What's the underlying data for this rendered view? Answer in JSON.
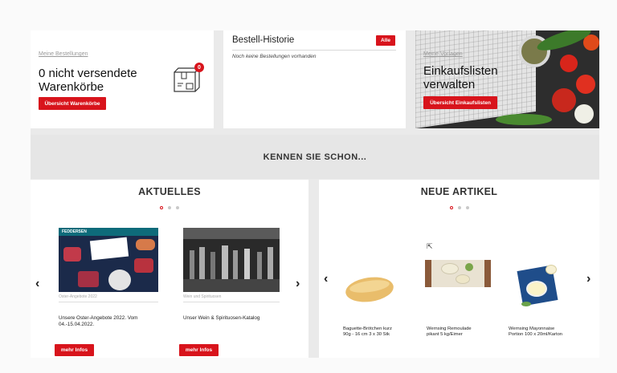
{
  "cards": {
    "orders": {
      "link": "Meine Bestellungen",
      "title_line1": "0 nicht versendete",
      "title_line2": "Warenkörbe",
      "button": "Übersicht Warenkörbe",
      "badge": "0"
    },
    "history": {
      "title": "Bestell-Historie",
      "button": "Alle",
      "empty": "Noch keine Bestellungen vorhanden"
    },
    "lists": {
      "link": "Meine Vorlagen",
      "title_line1": "Einkaufslisten",
      "title_line2": "verwalten",
      "button": "Übersicht Einkaufslisten"
    }
  },
  "banner": {
    "title": "KENNEN SIE SCHON..."
  },
  "aktuelles": {
    "title": "AKTUELLES",
    "items": [
      {
        "caption": "Oster-Angebote 2022",
        "text_line1": "Unsere Oster-Angebote 2022. Vom",
        "text_line2": "04.-15.04.2022.",
        "button": "mehr Infos",
        "brand": "FEDDERSEN"
      },
      {
        "caption": "Wein und Spirituosen",
        "text_line1": "Unser Wein & Spirituosen-Katalog",
        "text_line2": "",
        "button": "mehr Infos"
      }
    ]
  },
  "neue_artikel": {
    "title": "NEUE ARTIKEL",
    "items": [
      {
        "line1": "Baguette-Brötchen kurz",
        "line2": "90g - 16 cm 3 x 30 Stk"
      },
      {
        "line1": "Wernsing Remoulade",
        "line2": "pikant 5 kg/Eimer"
      },
      {
        "line1": "Wernsing Mayonnaise",
        "line2": "Portion 100 x 20ml/Karton"
      }
    ]
  },
  "colors": {
    "accent": "#d8141c",
    "panel_bg": "#eaeaea"
  }
}
